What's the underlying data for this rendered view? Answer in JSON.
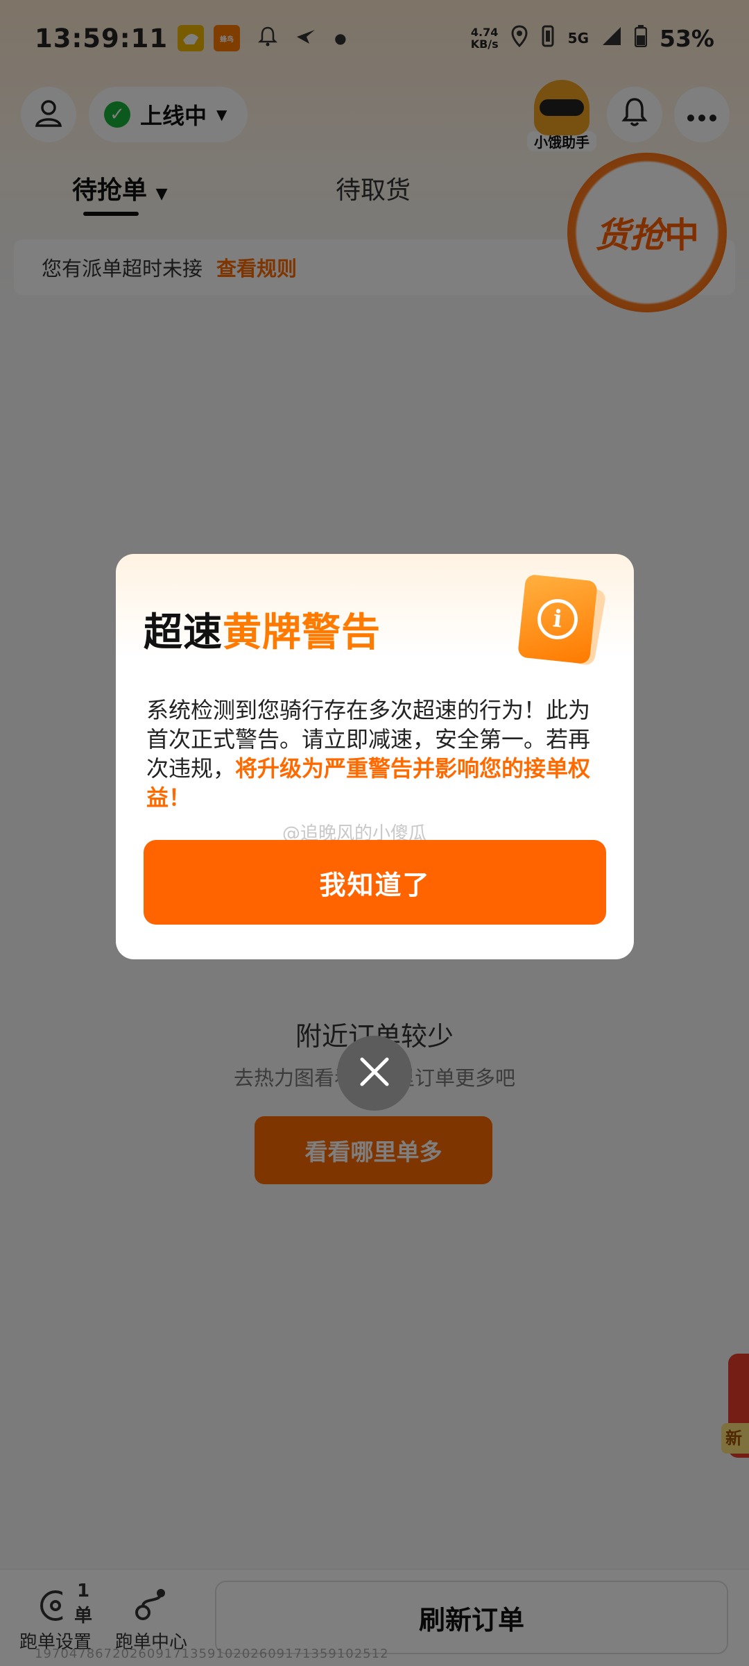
{
  "status_bar": {
    "time": "13:59:11",
    "app_icon_label": "蜂鸟",
    "net_speed_value": "4.74",
    "net_speed_unit": "KB/s",
    "network": "5G",
    "battery": "53%"
  },
  "header": {
    "online_status": "上线中",
    "helper_label": "小饿助手"
  },
  "tabs": [
    {
      "label": "待抢单"
    },
    {
      "label": "待取货"
    }
  ],
  "grab_badge": {
    "prefix": "货抢",
    "suffix": "中"
  },
  "notice": {
    "text": "您有派单超时未接",
    "link": "查看规则"
  },
  "empty_state": {
    "title": "附近订单较少",
    "subtitle": "去热力图看看，哪里订单更多吧",
    "button": "看看哪里单多"
  },
  "dialog": {
    "title_part1": "超速",
    "title_part2": "黄牌警告",
    "body_text": "系统检测到您骑行存在多次超速的行为！此为首次正式警告。请立即减速，安全第一。若再次违规，",
    "body_highlight": "将升级为严重警告并影响您的接单权益！",
    "confirm_button": "我知道了",
    "watermark": "@追晚风的小傻瓜"
  },
  "bottom_bar": {
    "settings_badge": "1单",
    "settings_label": "跑单设置",
    "center_label": "跑单中心",
    "refresh_label": "刷新订单",
    "order_id": "19704786720260917135910202609171359102512"
  },
  "side_peek_tag": "新",
  "colors": {
    "brand_orange": "#ff6400",
    "highlight_orange": "#ff7a00",
    "online_green": "#18b23c"
  }
}
